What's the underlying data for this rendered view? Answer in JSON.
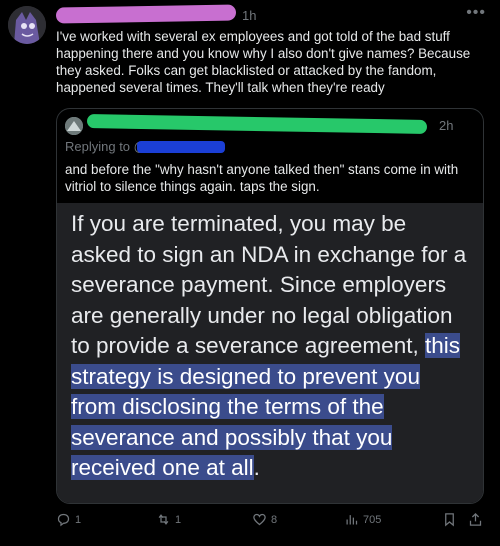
{
  "post": {
    "time": "1h",
    "text": "I've worked with several ex employees and got told of the bad stuff happening there and you know why I also don't give names? Because they asked. Folks can get blacklisted or attacked by the fandom, happened several times. They'll talk when they're ready"
  },
  "quote": {
    "time": "2h",
    "replying_to": "Replying to @",
    "text": "and before the \"why hasn't anyone talked then\" stans come in with vitriol to silence things again. taps the sign.",
    "image_text_plain": "If you are terminated, you may be asked to sign an NDA in exchange for a severance payment. Since employers are generally under no legal obligation to provide a severance agreement, ",
    "image_text_highlight": "this strategy is designed to prevent you from disclosing the terms of the severance and possibly that you received one at all",
    "image_text_end": "."
  },
  "actions": {
    "replies": "1",
    "reposts": "1",
    "likes": "8",
    "views": "705"
  },
  "colors": {
    "name_redaction": "#c86fd0",
    "quote_name_redaction": "#27c86a",
    "reply_redaction": "#1b3fd6",
    "highlight": "#3b4c8c"
  }
}
